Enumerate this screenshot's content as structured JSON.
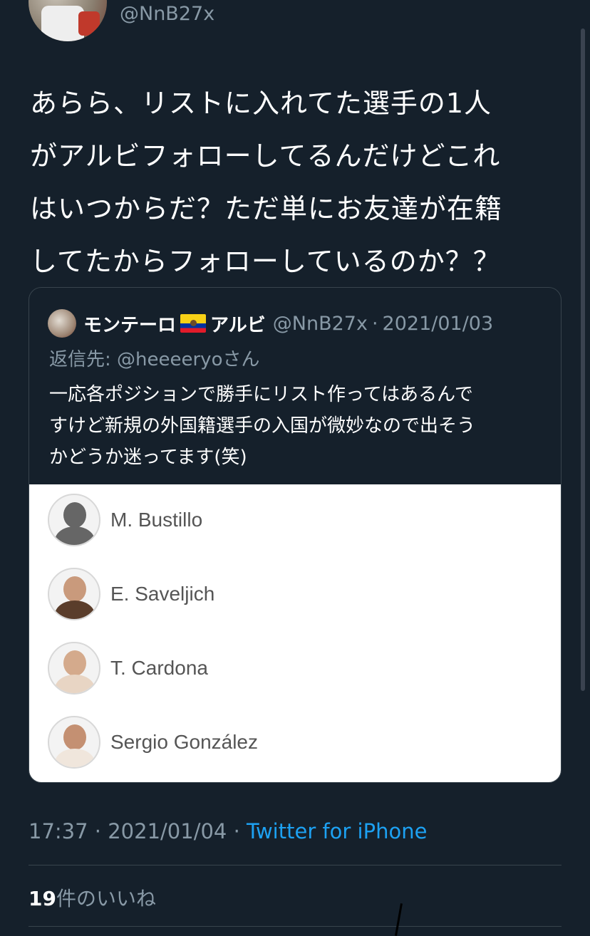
{
  "author": {
    "handle": "@NnB27x"
  },
  "tweet": {
    "lines": [
      "あらら、リストに入れてた選手の1人",
      "がアルビフォローしてるんだけどこれ",
      "はいつからだ？ただ単にお友達が在籍",
      "してたからフォローしているのか？？"
    ]
  },
  "quote": {
    "name": "モンテーロ",
    "name_suffix": "アルビ",
    "handle": "@NnB27x",
    "separator": "·",
    "date": "2021/01/03",
    "reply_to": "返信先: @heeeeryoさん",
    "lines": [
      "一応各ポジションで勝手にリスト作ってはあるんで",
      "すけど新規の外国籍選手の入国が微妙なので出そう",
      "かどうか迷ってます(笑)"
    ],
    "players": [
      {
        "name": "M. Bustillo"
      },
      {
        "name": "E. Saveljich"
      },
      {
        "name": "T. Cardona"
      },
      {
        "name": "Sergio González"
      }
    ]
  },
  "meta": {
    "time": "17:37",
    "separator": "·",
    "date": "2021/01/04",
    "source": "Twitter for iPhone"
  },
  "likes": {
    "count": "19",
    "label": "件のいいね"
  },
  "colors": {
    "background": "#15202b",
    "secondary_text": "#8899a6",
    "link": "#1da1f2",
    "border": "#38444d"
  }
}
